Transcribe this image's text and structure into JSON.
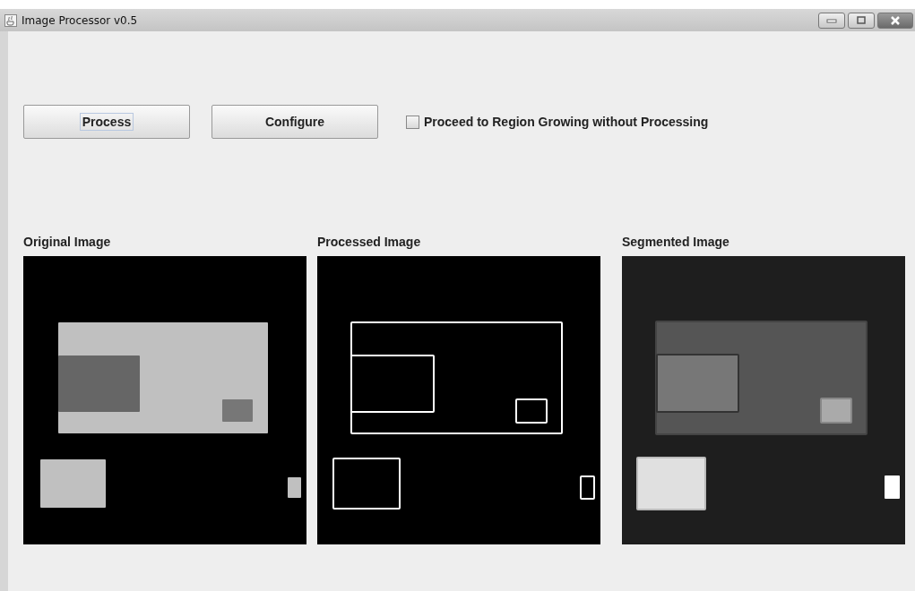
{
  "window": {
    "title": "Image Processor v0.5"
  },
  "buttons": [
    {
      "label": "Process",
      "focused": true
    },
    {
      "label": "Configure",
      "focused": false
    }
  ],
  "checkbox": {
    "label": "Proceed to Region Growing without Processing",
    "checked": false
  },
  "panels": [
    {
      "title": "Original Image",
      "kind": "picture"
    },
    {
      "title": "Processed Image",
      "kind": "picture"
    },
    {
      "title": "Segmented Image",
      "kind": "picture"
    }
  ]
}
